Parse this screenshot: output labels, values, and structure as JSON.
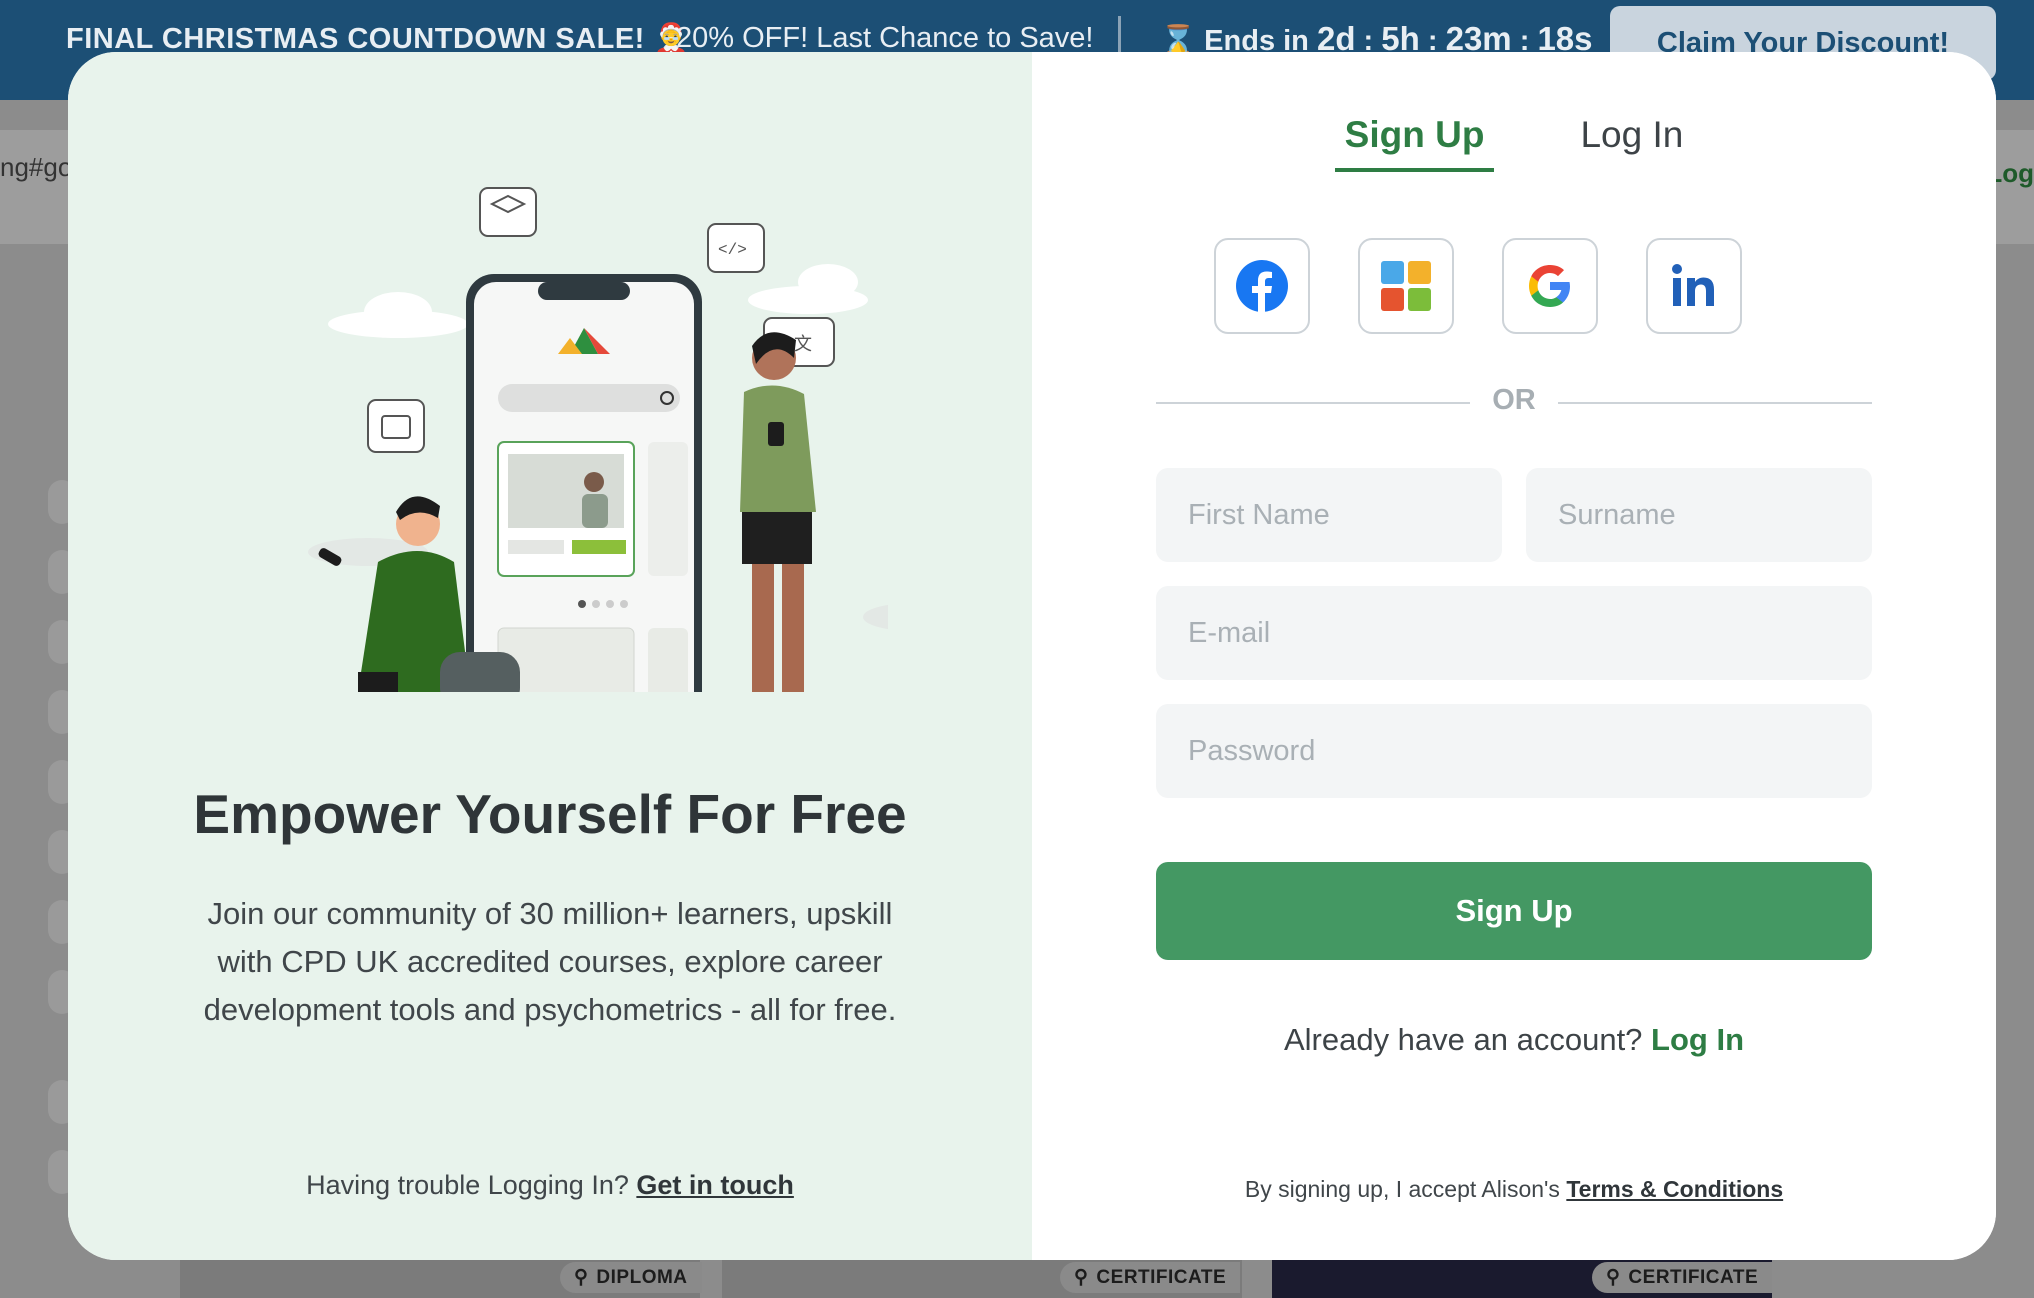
{
  "promo": {
    "title": "FINAL CHRISTMAS COUNTDOWN SALE! 🤶",
    "subtitle": "20% OFF! Last Chance to Save!",
    "timer_prefix": "Ends in",
    "days": "2d",
    "hours": "5h",
    "minutes": "23m",
    "seconds": "18s",
    "sep": ":",
    "button": "Claim Your Discount!",
    "color": "#1c4f75"
  },
  "background": {
    "url_fragment": "ng#goo",
    "login_fragment": "Log",
    "tags": [
      "DIPLOMA",
      "CERTIFICATE",
      "CERTIFICATE"
    ]
  },
  "left": {
    "headline": "Empower Yourself For Free",
    "description": "Join our community of 30 million+ learners, upskill with CPD UK accredited courses, explore career development tools and psychometrics - all for free.",
    "trouble_text": "Having trouble Logging In?",
    "trouble_link": "Get in touch"
  },
  "right": {
    "tabs": [
      {
        "label": "Sign Up",
        "active": true
      },
      {
        "label": "Log In",
        "active": false
      }
    ],
    "socials": [
      "facebook-icon",
      "microsoft-icon",
      "google-icon",
      "linkedin-icon"
    ],
    "or": "OR",
    "fields": {
      "first_name": "First Name",
      "surname": "Surname",
      "email": "E-mail",
      "password": "Password"
    },
    "submit": "Sign Up",
    "already_text": "Already have an account?",
    "already_link": "Log In",
    "terms_text": "By signing up, I accept Alison's",
    "terms_link": "Terms & Conditions",
    "accent": "#2e7d44",
    "button_color": "#449863"
  }
}
